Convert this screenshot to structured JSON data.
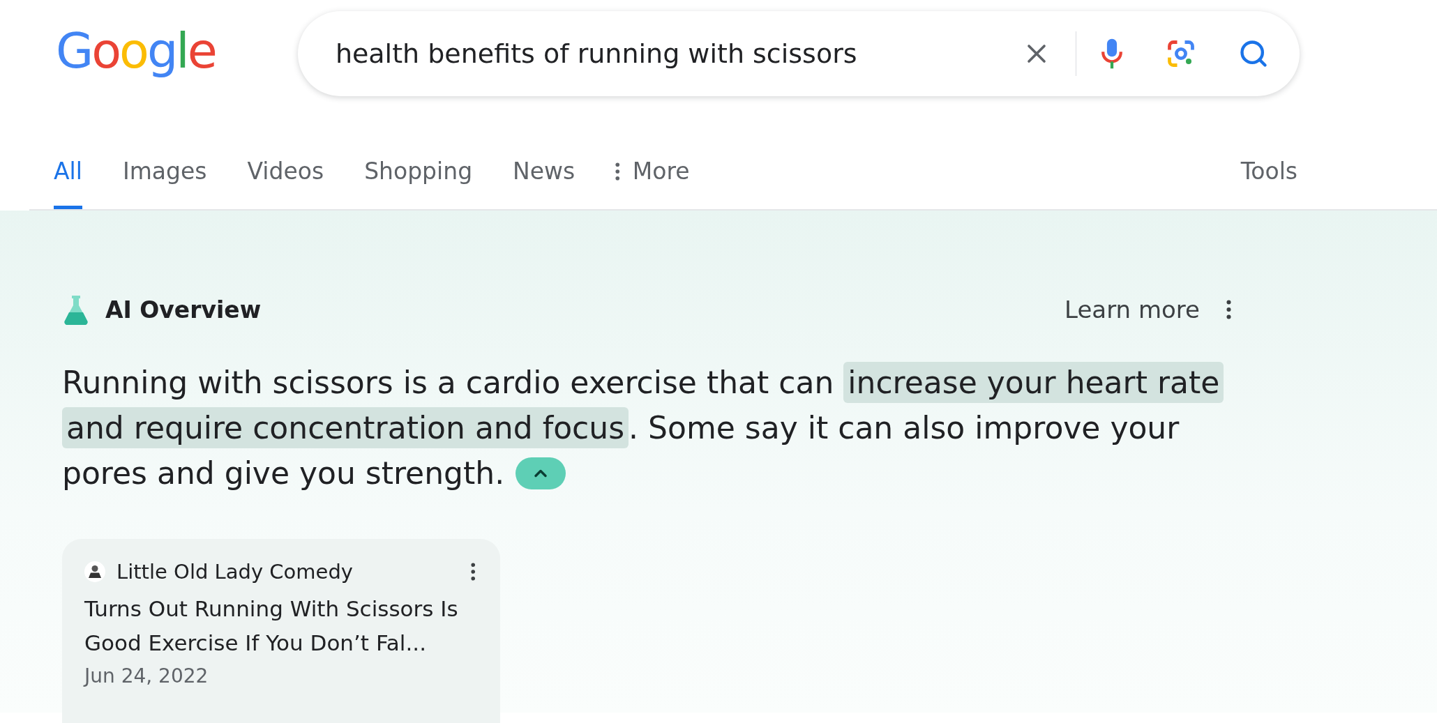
{
  "logo": "Google",
  "search": {
    "value": "health benefits of running with scissors"
  },
  "tabs": [
    {
      "label": "All",
      "selected": true
    },
    {
      "label": "Images",
      "selected": false
    },
    {
      "label": "Videos",
      "selected": false
    },
    {
      "label": "Shopping",
      "selected": false
    },
    {
      "label": "News",
      "selected": false
    },
    {
      "label": "More",
      "selected": false,
      "kind": "menu"
    }
  ],
  "tools": "Tools",
  "ai_overview": {
    "title": "AI Overview",
    "learn_more": "Learn more",
    "lines": [
      [
        {
          "text": "Running with scissors is a cardio exercise that can ",
          "highlighted": false
        },
        {
          "text": "increase your heart rate",
          "highlighted": true
        }
      ],
      [
        {
          "text": "and require concentration and focus",
          "highlighted": true
        },
        {
          "text": ". Some say it can also improve your",
          "highlighted": false
        }
      ],
      [
        {
          "text": "pores and give you strength.",
          "highlighted": false
        }
      ]
    ],
    "expanded": true,
    "source": {
      "site": "Little Old Lady Comedy",
      "title": "Turns Out Running With Scissors Is Good Exercise If You Don’t Fal...",
      "date": "Jun 24, 2022"
    }
  }
}
